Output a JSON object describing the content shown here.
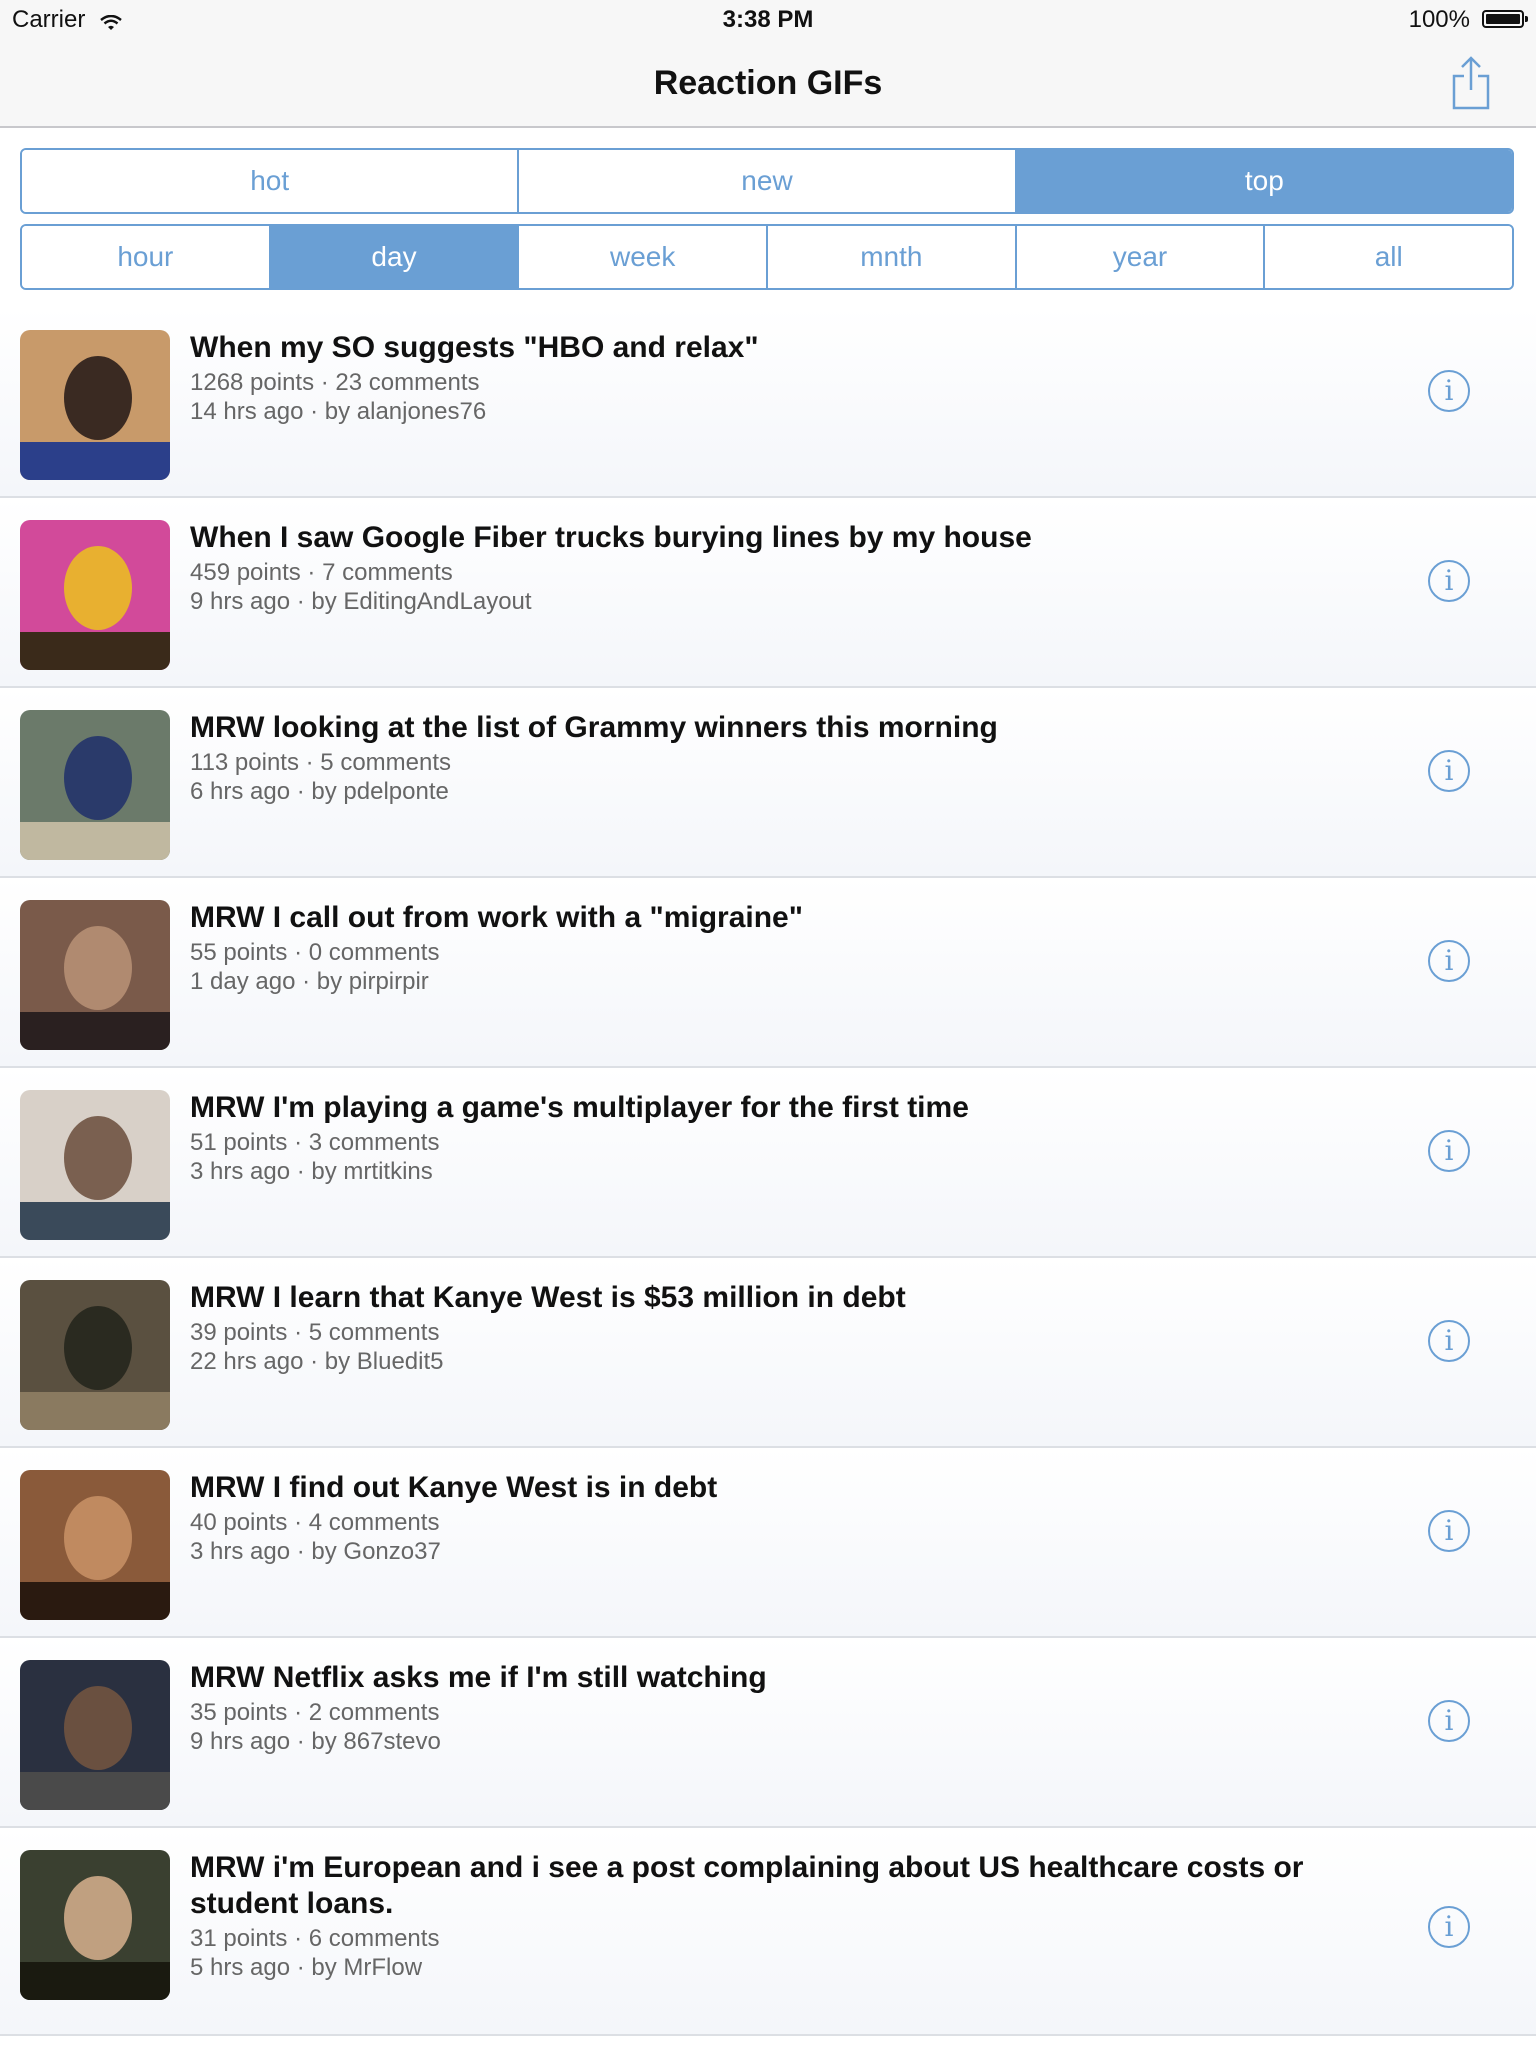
{
  "status_bar": {
    "carrier": "Carrier",
    "time": "3:38 PM",
    "battery": "100%"
  },
  "nav": {
    "title": "Reaction GIFs"
  },
  "sort_tabs": [
    {
      "label": "hot",
      "active": false
    },
    {
      "label": "new",
      "active": false
    },
    {
      "label": "top",
      "active": true
    }
  ],
  "time_tabs": [
    {
      "label": "hour",
      "active": false
    },
    {
      "label": "day",
      "active": true
    },
    {
      "label": "week",
      "active": false
    },
    {
      "label": "mnth",
      "active": false
    },
    {
      "label": "year",
      "active": false
    },
    {
      "label": "all",
      "active": false
    }
  ],
  "posts": [
    {
      "title": "When my SO suggests \"HBO and relax\"",
      "points": "1268 points · 23 comments",
      "meta": "14 hrs ago · by alanjones76",
      "thumb_colors": [
        "#c89a6a",
        "#3a2a22",
        "#2b3f8a"
      ]
    },
    {
      "title": "When I saw Google Fiber trucks burying lines by my house",
      "points": "459 points · 7 comments",
      "meta": "9 hrs ago · by EditingAndLayout",
      "thumb_colors": [
        "#d24a9a",
        "#e8b030",
        "#3a2a1a"
      ]
    },
    {
      "title": "MRW looking at the list of Grammy winners this morning",
      "points": "113 points · 5 comments",
      "meta": "6 hrs ago · by pdelponte",
      "thumb_colors": [
        "#6b7a6a",
        "#2a3a6a",
        "#c0b8a0"
      ]
    },
    {
      "title": "MRW I call out from work with a \"migraine\"",
      "points": "55 points · 0 comments",
      "meta": "1 day ago · by pirpirpir",
      "thumb_colors": [
        "#7a5a4a",
        "#b08a70",
        "#2a2020"
      ]
    },
    {
      "title": "MRW I'm playing a game's multiplayer for the first time",
      "points": "51 points · 3 comments",
      "meta": "3 hrs ago · by mrtitkins",
      "thumb_colors": [
        "#d8d0c8",
        "#7a6050",
        "#3a4a5a"
      ]
    },
    {
      "title": "MRW I learn that Kanye West is $53 million in debt",
      "points": "39 points · 5 comments",
      "meta": "22 hrs ago · by Bluedit5",
      "thumb_colors": [
        "#5a5040",
        "#2a2a20",
        "#8a7a60"
      ]
    },
    {
      "title": "MRW I find out Kanye West is in debt",
      "points": "40 points · 4 comments",
      "meta": "3 hrs ago · by Gonzo37",
      "thumb_colors": [
        "#8a5a3a",
        "#c08a60",
        "#2a1a10"
      ]
    },
    {
      "title": "MRW Netflix asks me if I'm still watching",
      "points": "35 points · 2 comments",
      "meta": "9 hrs ago · by 867stevo",
      "thumb_colors": [
        "#2a3040",
        "#6a5040",
        "#4a4a4a"
      ]
    },
    {
      "title": "MRW i'm European and i see a post complaining about US healthcare costs or student loans.",
      "points": "31 points · 6 comments",
      "meta": "5 hrs ago · by MrFlow",
      "thumb_colors": [
        "#3a4030",
        "#c0a080",
        "#1a1a10"
      ]
    }
  ],
  "colors": {
    "accent": "#6a9fd4",
    "nav_bg": "#f7f7f7",
    "meta_text": "#666666"
  },
  "icons": {
    "share": "share-icon",
    "info": "info-icon",
    "wifi": "wifi-icon",
    "battery": "battery-icon"
  }
}
